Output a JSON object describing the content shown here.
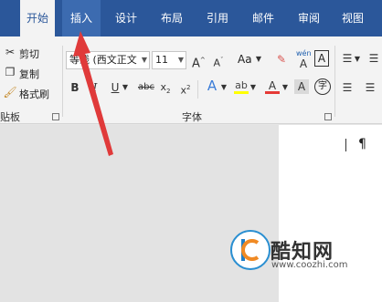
{
  "tabs": [
    {
      "label": "开始"
    },
    {
      "label": "插入"
    },
    {
      "label": "设计"
    },
    {
      "label": "布局"
    },
    {
      "label": "引用"
    },
    {
      "label": "邮件"
    },
    {
      "label": "审阅"
    },
    {
      "label": "视图"
    }
  ],
  "clipboard": {
    "cut": "剪切",
    "copy": "复制",
    "format_painter": "格式刷",
    "group_label": "贴板"
  },
  "font": {
    "name": "等线 (西文正文",
    "size": "11",
    "group_label": "字体",
    "change_case": "Aa",
    "phonetic": "wén",
    "char_border": "A",
    "enclose": "字"
  },
  "watermark": {
    "brand": "酷知网",
    "url": "www.coozhi.com"
  },
  "colors": {
    "tab_bar": "#2b579a",
    "annotation_arrow": "#e03a3a",
    "highlight": "#ffff00",
    "font_color": "#e53935"
  }
}
